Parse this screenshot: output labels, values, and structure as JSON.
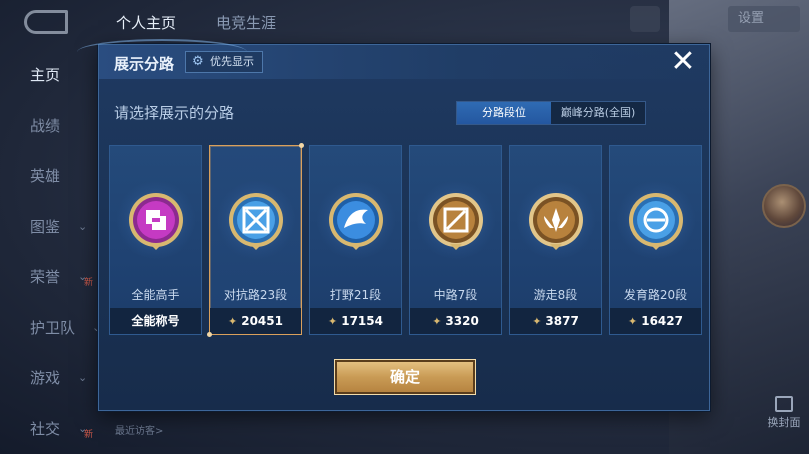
{
  "background": {
    "top_tabs": [
      "个人主页",
      "电竞生涯"
    ],
    "settings_label": "设置",
    "sidebar": [
      {
        "label": "主页",
        "active": true
      },
      {
        "label": "战绩"
      },
      {
        "label": "英雄"
      },
      {
        "label": "图鉴",
        "chevron": "⌄"
      },
      {
        "label": "荣誉",
        "chevron": "⌄",
        "new": "新"
      },
      {
        "label": "护卫队",
        "chevron": "⌄"
      },
      {
        "label": "游戏",
        "chevron": "⌄"
      },
      {
        "label": "社交",
        "chevron": "⌄",
        "new": "新"
      }
    ],
    "visitors_label": "最近访客>",
    "replace_label": "换封面"
  },
  "dialog": {
    "title": "展示分路",
    "priority_label": "优先显示",
    "close_icon": "✕",
    "subtitle": "请选择展示的分路",
    "toggle": [
      "分路段位",
      "巅峰分路(全国)"
    ],
    "confirm_label": "确定"
  },
  "cards": [
    {
      "label": "全能高手",
      "foot": "全能称号",
      "badge_color": "#c53ac3",
      "selected": false
    },
    {
      "label": "对抗路23段",
      "foot": "20451",
      "badge_color": "#4aa0e6",
      "selected": true
    },
    {
      "label": "打野21段",
      "foot": "17154",
      "badge_color": "#3b8de0",
      "selected": false
    },
    {
      "label": "中路7段",
      "foot": "3320",
      "badge_color": "#b8823d",
      "selected": false
    },
    {
      "label": "游走8段",
      "foot": "3877",
      "badge_color": "#b8823d",
      "selected": false
    },
    {
      "label": "发育路20段",
      "foot": "16427",
      "badge_color": "#4aa0e6",
      "selected": false
    }
  ],
  "colors": {
    "dialog_bg": "#1c3659",
    "gold": "#d9a05c",
    "accent_blue": "#2f6bb3"
  }
}
